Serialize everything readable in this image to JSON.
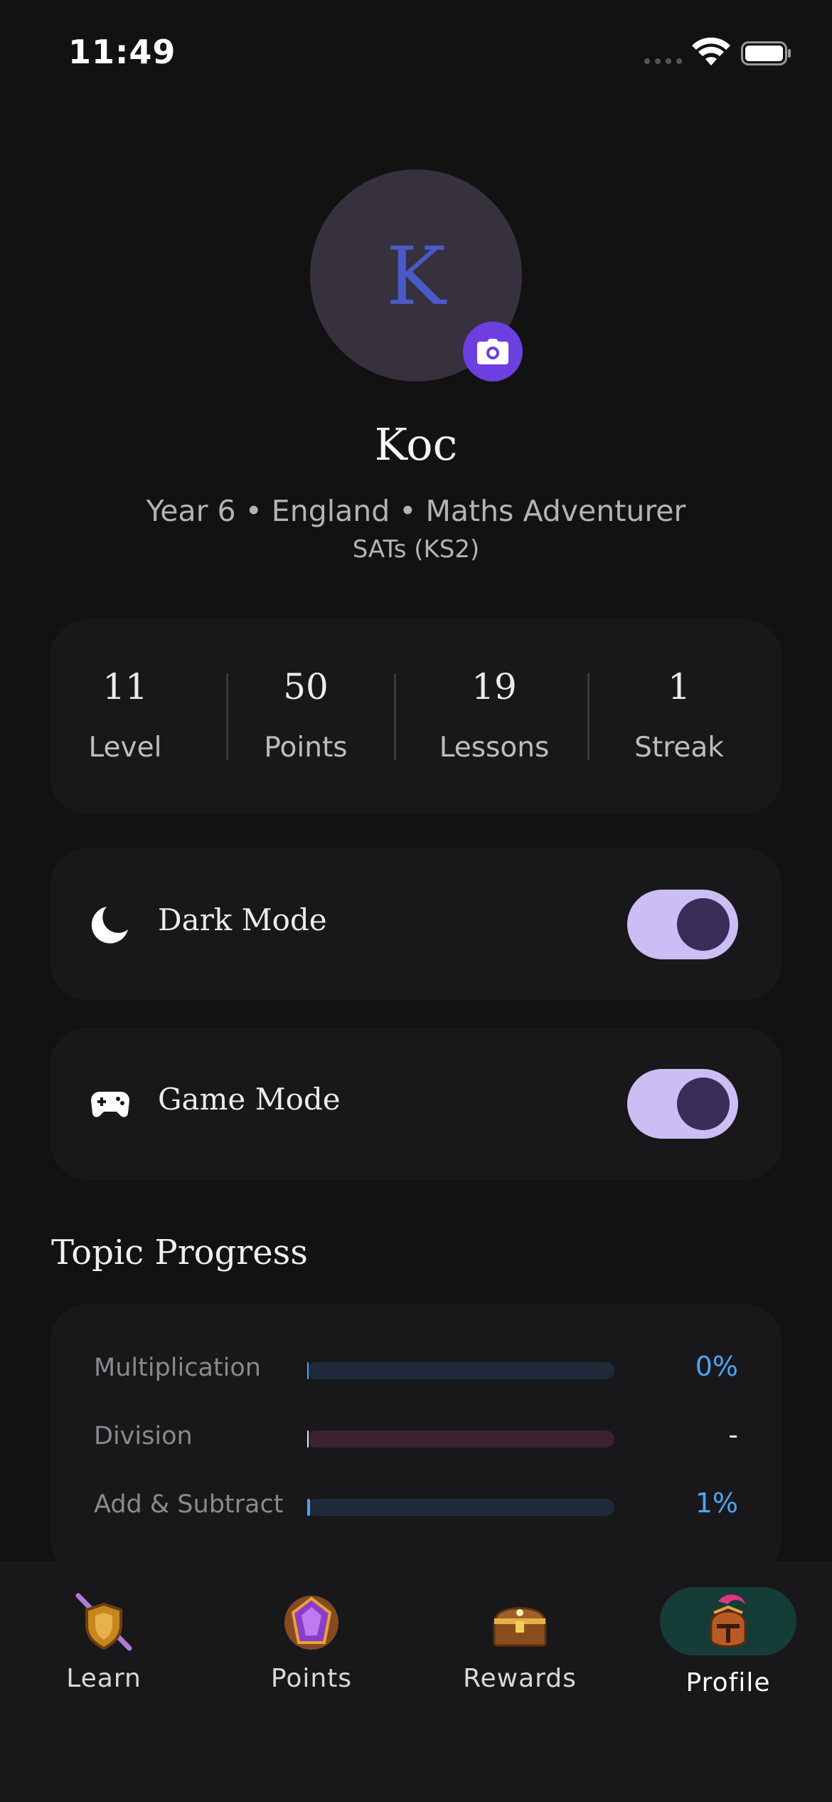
{
  "status_bar": {
    "time": "11:49"
  },
  "profile": {
    "avatar_letter": "K",
    "name": "Koc",
    "subtitle": "Year 6 • England • Maths Adventurer",
    "exam": "SATs (KS2)"
  },
  "stats": [
    {
      "value": "11",
      "label": "Level"
    },
    {
      "value": "50",
      "label": "Points"
    },
    {
      "value": "19",
      "label": "Lessons"
    },
    {
      "value": "1",
      "label": "Streak"
    }
  ],
  "settings": {
    "dark_mode": {
      "label": "Dark Mode",
      "icon": "moon-icon",
      "enabled": true
    },
    "game_mode": {
      "label": "Game Mode",
      "icon": "gamepad-icon",
      "enabled": true
    }
  },
  "topic_progress": {
    "title": "Topic Progress",
    "topics": [
      {
        "label": "Multiplication",
        "value": "0%",
        "progress": 0,
        "color": "#4ea3f2",
        "track": "#1f2a3a"
      },
      {
        "label": "Division",
        "value": "-",
        "progress": 0,
        "color": "#e5e5e5",
        "track": "#3a2230"
      },
      {
        "label": "Add & Subtract",
        "value": "1%",
        "progress": 0.01,
        "color": "#4ea3f2",
        "track": "#1f2a3a"
      }
    ]
  },
  "nav": {
    "items": [
      {
        "label": "Learn",
        "icon": "sword-shield-icon"
      },
      {
        "label": "Points",
        "icon": "gem-icon"
      },
      {
        "label": "Rewards",
        "icon": "treasure-chest-icon"
      },
      {
        "label": "Profile",
        "icon": "knight-helmet-icon"
      }
    ],
    "active": "Profile"
  },
  "colors": {
    "background": "#121212",
    "card": "#18181b",
    "accent": "#6d3ee0",
    "toggle_on": "#cdbdf5",
    "progress": "#4ea3f2",
    "nav_active": "#163c37"
  }
}
